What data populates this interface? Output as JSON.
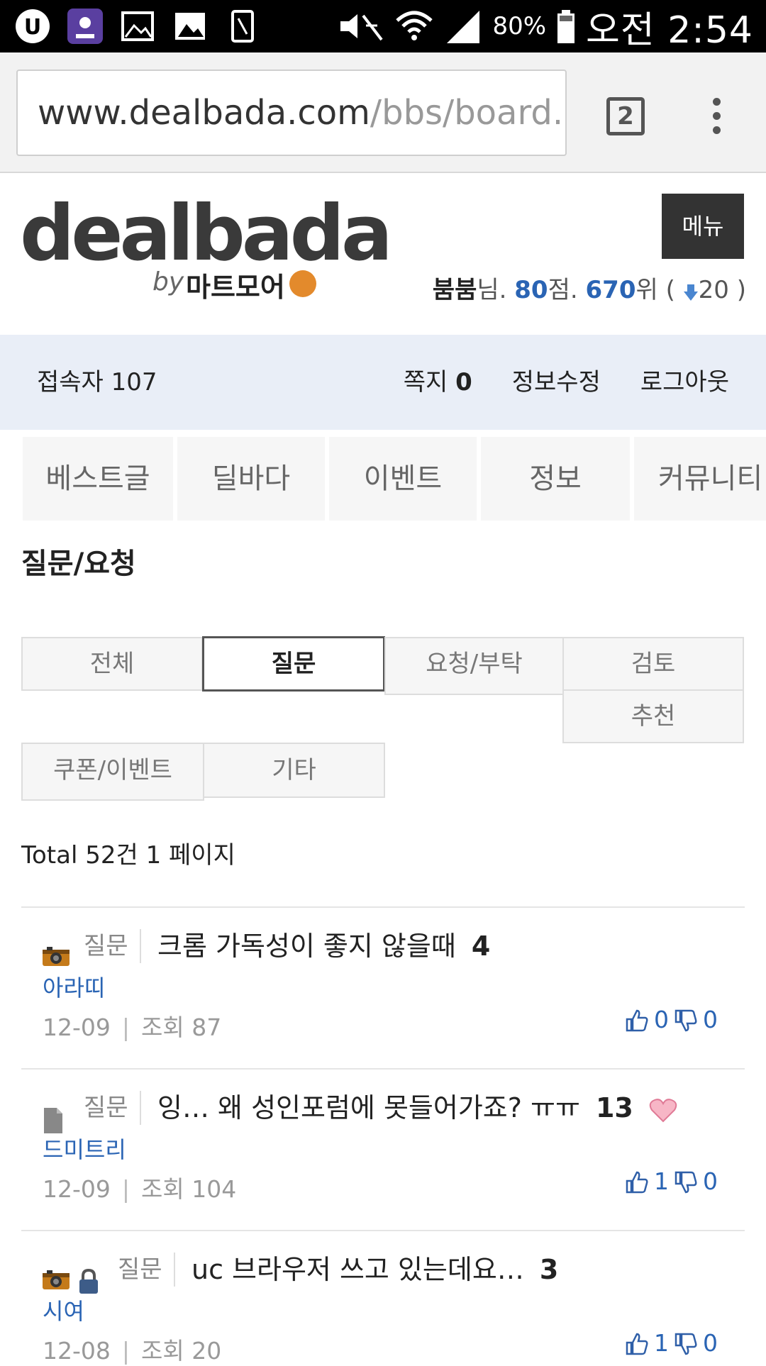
{
  "status_bar": {
    "battery": "80%",
    "time": "오전 2:54",
    "icons": [
      "u-app-icon",
      "podcast-app-icon",
      "image-icon",
      "gallery-icon",
      "phone-icon",
      "mute-icon",
      "wifi-icon",
      "signal-icon",
      "battery-icon"
    ]
  },
  "browser": {
    "url_host": "www.dealbada.com",
    "url_path": "/bbs/board.",
    "tab_count": "2"
  },
  "header": {
    "logo": "dealbada",
    "logo_by": "by",
    "logo_sub": "마트모어",
    "menu_label": "메뉴",
    "user": {
      "name": "붐붐",
      "suffix_name": "님. ",
      "points": "80",
      "suffix_points": "점. ",
      "rank": "670",
      "suffix_rank": "위 (",
      "rank_change": "20",
      "close": " )"
    }
  },
  "info_bar": {
    "visitors": "접속자 107",
    "messages_label": "쪽지",
    "messages_count": "0",
    "edit_label": "정보수정",
    "logout_label": "로그아웃"
  },
  "nav": [
    "베스트글",
    "딜바다",
    "이벤트",
    "정보",
    "커뮤니티"
  ],
  "board": {
    "title": "질문/요청",
    "categories": [
      "전체",
      "질문",
      "요청/부탁",
      "검토",
      "추천",
      "쿠폰/이벤트",
      "기타"
    ],
    "active_category": "질문",
    "total": "Total 52건 1 페이지"
  },
  "posts": [
    {
      "category": "질문",
      "title": "크롬 가독성이 좋지 않을때",
      "comments": "4",
      "author": "아라띠",
      "date": "12-09",
      "views": "조회 87",
      "likes": "0",
      "dislikes": "0",
      "icons": [
        "camera-icon"
      ]
    },
    {
      "category": "질문",
      "title": "잉… 왜 성인포럼에 못들어가죠? ㅠㅠ",
      "comments": "13",
      "author": "드미트리",
      "date": "12-09",
      "views": "조회 104",
      "likes": "1",
      "dislikes": "0",
      "icons": [
        "document-icon",
        "heart-icon"
      ]
    },
    {
      "category": "질문",
      "title": "uc 브라우저 쓰고 있는데요…",
      "comments": "3",
      "author": "시여",
      "date": "12-08",
      "views": "조회 20",
      "likes": "1",
      "dislikes": "0",
      "icons": [
        "camera-icon",
        "lock-icon"
      ]
    }
  ],
  "colors": {
    "accent": "#2a64b4",
    "infobar_bg": "#e9eef7",
    "menu_bg": "#333333"
  }
}
